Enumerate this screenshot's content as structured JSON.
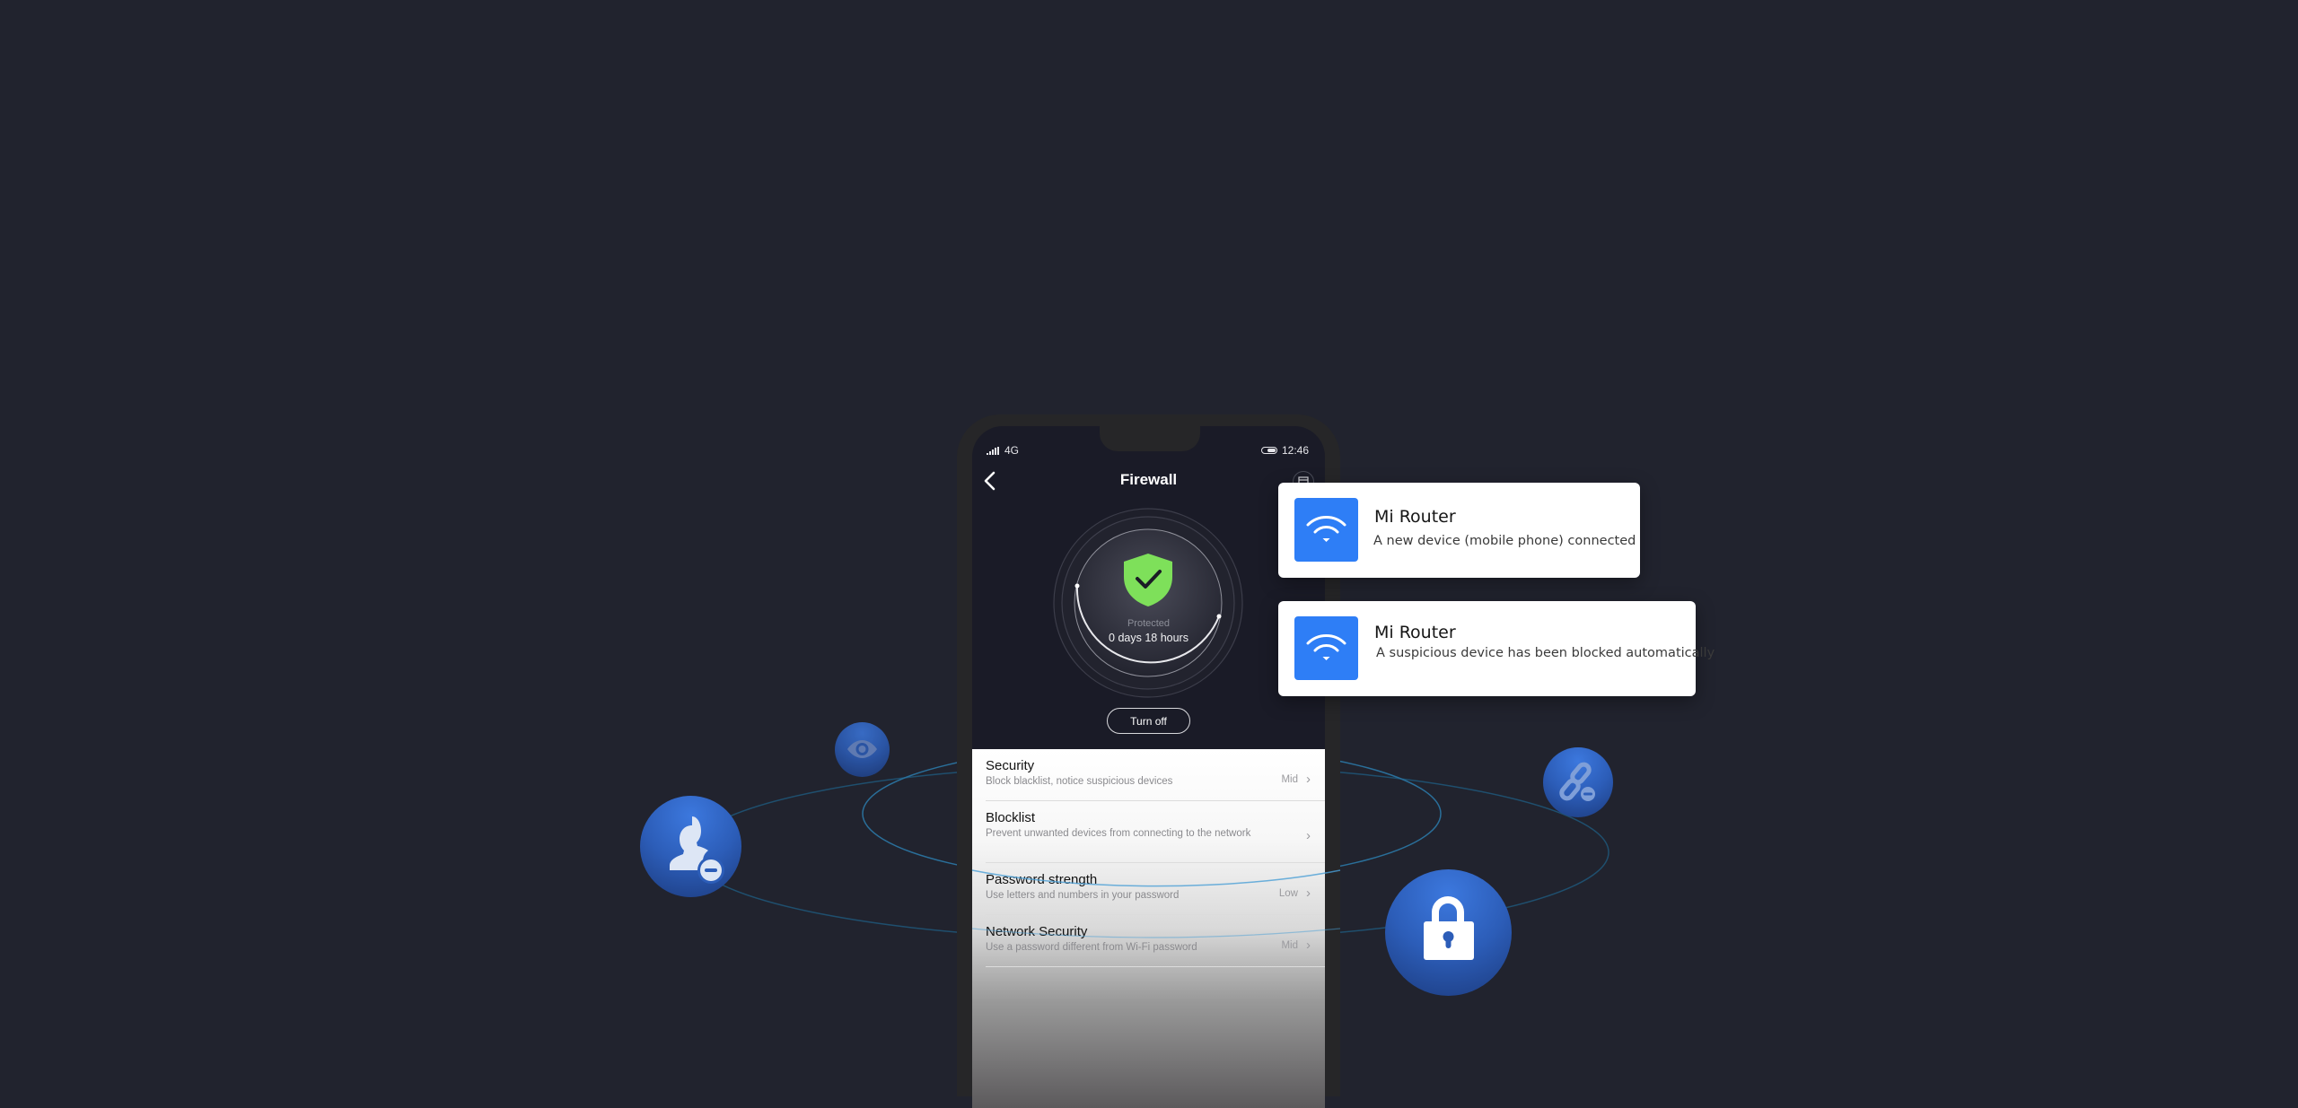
{
  "status_bar": {
    "network": "4G",
    "time": "12:46"
  },
  "header": {
    "title": "Firewall",
    "back_icon": "chevron-left-icon",
    "calendar_icon": "calendar-icon"
  },
  "protection": {
    "icon": "shield-check-icon",
    "status_label": "Protected",
    "duration": "0 days 18 hours",
    "turn_off_label": "Turn off",
    "shield_color": "#7ee05a"
  },
  "settings": [
    {
      "title": "Security",
      "subtitle": "Block blacklist, notice suspicious devices",
      "value": "Mid"
    },
    {
      "title": "Blocklist",
      "subtitle": "Prevent unwanted devices from connecting to the network",
      "value": ""
    },
    {
      "title": "Password strength",
      "subtitle": "Use letters and numbers in your password",
      "value": "Low"
    },
    {
      "title": "Network Security",
      "subtitle": "Use a password different from Wi-Fi password",
      "value": "Mid"
    }
  ],
  "notifications": [
    {
      "app": "Mi Router",
      "message": "A new device (mobile phone) connected",
      "icon": "wifi-icon"
    },
    {
      "app": "Mi Router",
      "message": "A suspicious device has been blocked automatically",
      "icon": "wifi-icon"
    }
  ],
  "orbit_icons": [
    "remove-user-icon",
    "eye-icon",
    "unlink-icon",
    "lock-icon"
  ],
  "colors": {
    "background": "#21232e",
    "accent_blue": "#2e7ef6",
    "orbit_line": "#2a6f9a"
  }
}
